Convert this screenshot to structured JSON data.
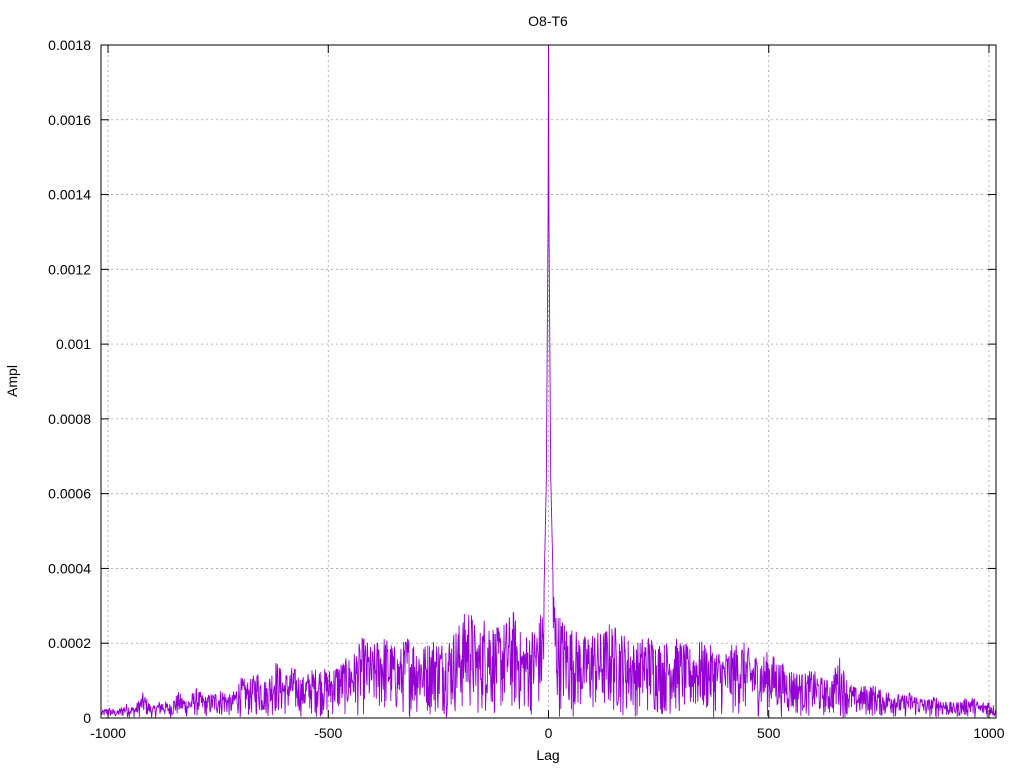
{
  "chart_data": {
    "type": "line",
    "title": "O8-T6",
    "xlabel": "Lag",
    "ylabel": "Ampl",
    "xlim": [
      -1016,
      1016
    ],
    "ylim": [
      0,
      0.0018
    ],
    "x_ticks": [
      -1000,
      -500,
      0,
      500,
      1000
    ],
    "x_tick_labels": [
      "-1000",
      "-500",
      "0",
      "500",
      "1000"
    ],
    "y_ticks": [
      0,
      0.0002,
      0.0004,
      0.0006,
      0.0008,
      0.001,
      0.0012,
      0.0014,
      0.0016,
      0.0018
    ],
    "y_tick_labels": [
      "0",
      "0.0002",
      "0.0004",
      "0.0006",
      "0.0008",
      "0.001",
      "0.0012",
      "0.0014",
      "0.0016",
      "0.0018"
    ],
    "grid": true,
    "legend": "none",
    "series": [
      {
        "color": "#9400d3",
        "points": [
          [
            -1015,
            2e-05
          ],
          [
            -1000,
            3e-05
          ],
          [
            -980,
            2e-05
          ],
          [
            -960,
            4e-05
          ],
          [
            -940,
            3e-05
          ],
          [
            -920,
            7e-05
          ],
          [
            -900,
            3e-05
          ],
          [
            -880,
            5e-05
          ],
          [
            -860,
            4e-05
          ],
          [
            -840,
            7e-05
          ],
          [
            -820,
            5e-05
          ],
          [
            -800,
            8e-05
          ],
          [
            -780,
            6e-05
          ],
          [
            -760,
            7e-05
          ],
          [
            -740,
            8e-05
          ],
          [
            -720,
            6e-05
          ],
          [
            -700,
            0.00011
          ],
          [
            -680,
            0.0001
          ],
          [
            -660,
            0.00013
          ],
          [
            -640,
            0.0001
          ],
          [
            -620,
            0.00016
          ],
          [
            -600,
            0.00012
          ],
          [
            -580,
            0.00014
          ],
          [
            -560,
            0.00011
          ],
          [
            -540,
            0.00013
          ],
          [
            -520,
            0.00014
          ],
          [
            -500,
            0.00013
          ],
          [
            -480,
            0.00015
          ],
          [
            -460,
            0.00016
          ],
          [
            -440,
            0.00018
          ],
          [
            -420,
            0.00022
          ],
          [
            -400,
            0.00019
          ],
          [
            -380,
            0.00023
          ],
          [
            -360,
            0.00021
          ],
          [
            -340,
            0.00018
          ],
          [
            -320,
            0.00023
          ],
          [
            -300,
            0.00021
          ],
          [
            -280,
            0.0002
          ],
          [
            -260,
            0.00022
          ],
          [
            -240,
            0.00021
          ],
          [
            -220,
            0.00023
          ],
          [
            -200,
            0.00026
          ],
          [
            -180,
            0.00031
          ],
          [
            -160,
            0.00022
          ],
          [
            -140,
            0.0003
          ],
          [
            -120,
            0.00024
          ],
          [
            -100,
            0.00026
          ],
          [
            -80,
            0.00029
          ],
          [
            -60,
            0.00022
          ],
          [
            -40,
            0.00024
          ],
          [
            -20,
            0.00027
          ],
          [
            -10,
            0.00035
          ],
          [
            -5,
            0.00063
          ],
          [
            -3,
            0.00098
          ],
          [
            -1,
            0.00133
          ],
          [
            0,
            0.0018
          ],
          [
            1,
            0.00134
          ],
          [
            3,
            0.001
          ],
          [
            5,
            0.00065
          ],
          [
            10,
            0.00039
          ],
          [
            20,
            0.00029
          ],
          [
            40,
            0.00026
          ],
          [
            60,
            0.00024
          ],
          [
            80,
            0.00022
          ],
          [
            100,
            0.00024
          ],
          [
            120,
            0.00023
          ],
          [
            140,
            0.00026
          ],
          [
            160,
            0.00024
          ],
          [
            180,
            0.00022
          ],
          [
            200,
            0.0002
          ],
          [
            220,
            0.00023
          ],
          [
            240,
            0.00022
          ],
          [
            260,
            0.0002
          ],
          [
            280,
            0.00022
          ],
          [
            300,
            0.00021
          ],
          [
            320,
            0.00019
          ],
          [
            340,
            0.00021
          ],
          [
            360,
            0.0002
          ],
          [
            380,
            0.00019
          ],
          [
            400,
            0.00018
          ],
          [
            420,
            0.0002
          ],
          [
            440,
            0.00021
          ],
          [
            460,
            0.00018
          ],
          [
            480,
            0.00017
          ],
          [
            500,
            0.00018
          ],
          [
            520,
            0.00016
          ],
          [
            540,
            0.00014
          ],
          [
            560,
            0.00013
          ],
          [
            580,
            0.00012
          ],
          [
            600,
            0.00013
          ],
          [
            620,
            0.00011
          ],
          [
            640,
            0.0001
          ],
          [
            660,
            0.00017
          ],
          [
            680,
            0.0001
          ],
          [
            700,
            8e-05
          ],
          [
            720,
            9e-05
          ],
          [
            740,
            9e-05
          ],
          [
            760,
            7e-05
          ],
          [
            780,
            8e-05
          ],
          [
            800,
            6e-05
          ],
          [
            820,
            7e-05
          ],
          [
            840,
            6e-05
          ],
          [
            860,
            5e-05
          ],
          [
            880,
            6e-05
          ],
          [
            900,
            5e-05
          ],
          [
            920,
            4e-05
          ],
          [
            940,
            5e-05
          ],
          [
            960,
            6e-05
          ],
          [
            980,
            4e-05
          ],
          [
            1000,
            5e-05
          ],
          [
            1015,
            3e-05
          ]
        ]
      }
    ]
  }
}
